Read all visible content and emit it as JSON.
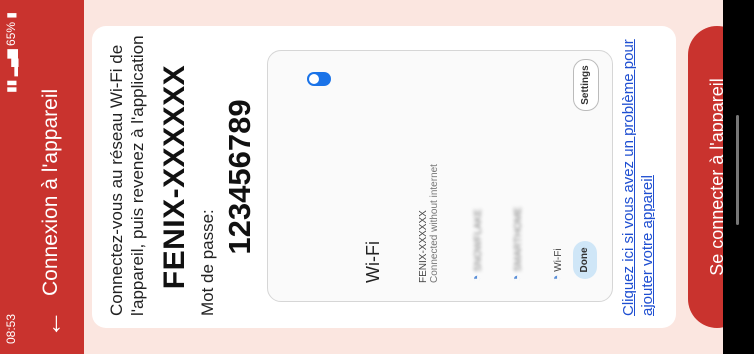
{
  "status_bar": {
    "time": "08:53",
    "battery": "65%"
  },
  "app_bar": {
    "title": "Connexion à l'appareil",
    "back_icon": "arrow-left-icon"
  },
  "instructions": "Connectez-vous au réseau Wi-Fi de l'appareil, puis revenez à l'application",
  "network_name": "FENIX-XXXXXX",
  "password_label": "Mot de passe:",
  "password": "123456789",
  "wifi_dialog": {
    "title": "Wi-Fi",
    "section_label": "Wi-Fi",
    "connected_network": "FENIX-XXXXXX",
    "connected_status": "Connected without internet",
    "other_networks": [
      "SNOWFLAKE",
      "SMARTHOME"
    ],
    "settings_label": "Settings",
    "done_label": "Done"
  },
  "help_link": "Cliquez ici si vous avez un problème pour ajouter votre appareil",
  "connect_button": "Se connecter à l'appareil",
  "colors": {
    "primary": "#c9332e",
    "background": "#fbe6e0",
    "link": "#1f4fd1"
  }
}
